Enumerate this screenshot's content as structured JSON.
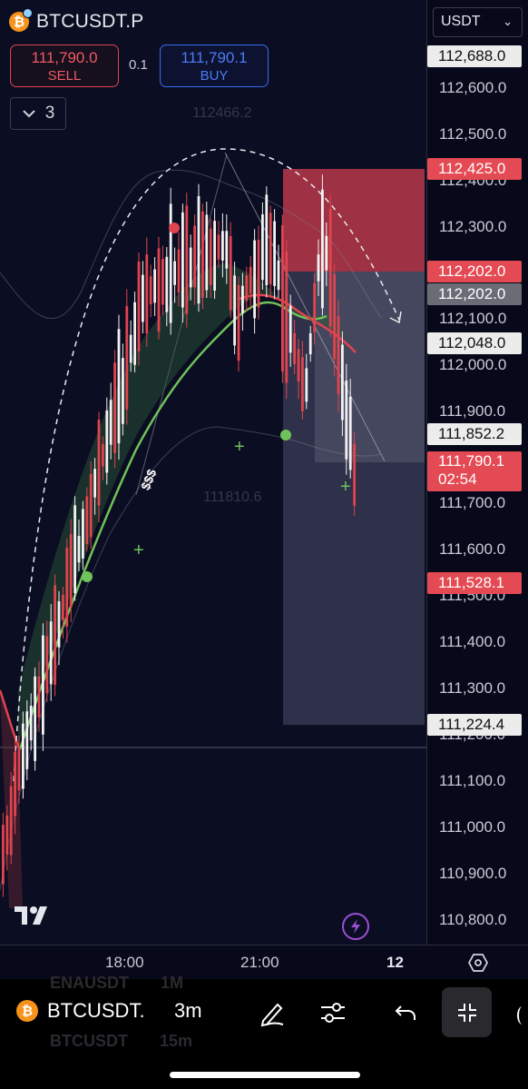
{
  "header": {
    "symbol": "BTCUSDT.P",
    "sell": {
      "price": "111,790.0",
      "label": "SELL"
    },
    "buy": {
      "price": "111,790.1",
      "label": "BUY"
    },
    "spread": "0.1",
    "indicator_count": "3",
    "currency": "USDT"
  },
  "chart_overlay": {
    "high_marker": "112466.2",
    "low_marker": "111810.6",
    "dollar_marks": "$$$"
  },
  "price_axis": {
    "ticks": [
      "112,600.0",
      "112,500.0",
      "112,400.0",
      "112,300.0",
      "112,100.0",
      "112,000.0",
      "111,900.0",
      "111,700.0",
      "111,600.0",
      "111,500.0",
      "111,400.0",
      "111,300.0",
      "111,200.0",
      "111,100.0",
      "111,000.0",
      "110,900.0",
      "110,800.0"
    ],
    "tags": {
      "t1": "112,688.0",
      "t2": "112,425.0",
      "t3": "112,202.0",
      "t4": "112,202.0",
      "t5": "112,048.0",
      "t6": "111,852.2",
      "t7_price": "111,790.1",
      "t7_timer": "02:54",
      "t8": "111,528.1",
      "t9": "111,224.4"
    }
  },
  "time_axis": {
    "labels": [
      "18:00",
      "21:00",
      "12"
    ]
  },
  "bottom_bar": {
    "symbol": "BTCUSDT.",
    "interval": "3m",
    "ghost_top_symbol": "ENAUSDT",
    "ghost_top_interval": "1M",
    "ghost_bottom_symbol": "BTCUSDT",
    "ghost_bottom_interval": "15m"
  },
  "colors": {
    "background": "#0b0d22",
    "up_candle": "#ffffff",
    "down_candle": "#e0444d",
    "ema_fast": "#6fc35a",
    "ema_slow": "#e0444d",
    "stop_zone": "#c0394a",
    "target_zone": "#3a3d55"
  },
  "icons": [
    "bitcoin-icon",
    "chevron-down-icon",
    "tradingview-logo-icon",
    "lightning-icon",
    "settings-hexagon-icon",
    "pencil-icon",
    "sliders-icon",
    "undo-icon",
    "fullscreen-collapse-icon"
  ]
}
